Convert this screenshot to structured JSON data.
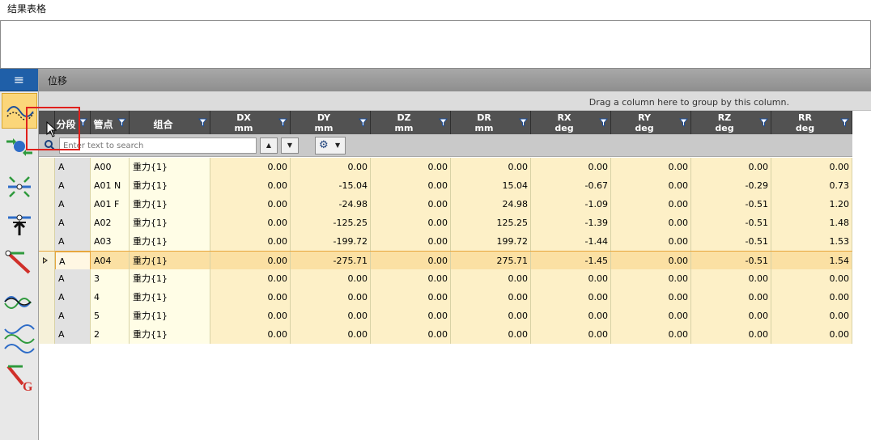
{
  "window": {
    "title": "结果表格"
  },
  "tab": {
    "label": "位移"
  },
  "group_panel": {
    "hint": "Drag a column here to group by this column."
  },
  "menu": {
    "icon": "≡"
  },
  "toolbar_tools": [
    {
      "name": "displacement-tool-icon",
      "active": true
    },
    {
      "name": "forces-tool-icon",
      "active": false
    },
    {
      "name": "stress-tool-icon",
      "active": false
    },
    {
      "name": "restraint-tool-icon",
      "active": false
    },
    {
      "name": "member-tool-icon",
      "active": false
    },
    {
      "name": "wave-tool-icon",
      "active": false
    },
    {
      "name": "modal-tool-icon",
      "active": false
    },
    {
      "name": "global-tool-icon",
      "active": false
    }
  ],
  "columns": [
    {
      "key": "seg",
      "line1": "分段",
      "line2": ""
    },
    {
      "key": "node",
      "line1": "管点",
      "line2": ""
    },
    {
      "key": "combo",
      "line1": "组合",
      "line2": ""
    },
    {
      "key": "dx",
      "line1": "DX",
      "line2": "mm"
    },
    {
      "key": "dy",
      "line1": "DY",
      "line2": "mm"
    },
    {
      "key": "dz",
      "line1": "DZ",
      "line2": "mm"
    },
    {
      "key": "dr",
      "line1": "DR",
      "line2": "mm"
    },
    {
      "key": "rx",
      "line1": "RX",
      "line2": "deg"
    },
    {
      "key": "ry",
      "line1": "RY",
      "line2": "deg"
    },
    {
      "key": "rz",
      "line1": "RZ",
      "line2": "deg"
    },
    {
      "key": "rr",
      "line1": "RR",
      "line2": "deg"
    }
  ],
  "search": {
    "placeholder": "Enter text to search",
    "up": "▲",
    "down": "▼",
    "gear": "⚙",
    "gear_dropdown": "▼"
  },
  "rows": [
    {
      "seg": "A",
      "node": "A00",
      "combo": "重力{1}",
      "dx": "0.00",
      "dy": "0.00",
      "dz": "0.00",
      "dr": "0.00",
      "rx": "0.00",
      "ry": "0.00",
      "rz": "0.00",
      "rr": "0.00",
      "selected": false
    },
    {
      "seg": "A",
      "node": "A01 N",
      "combo": "重力{1}",
      "dx": "0.00",
      "dy": "-15.04",
      "dz": "0.00",
      "dr": "15.04",
      "rx": "-0.67",
      "ry": "0.00",
      "rz": "-0.29",
      "rr": "0.73",
      "selected": false
    },
    {
      "seg": "A",
      "node": "A01 F",
      "combo": "重力{1}",
      "dx": "0.00",
      "dy": "-24.98",
      "dz": "0.00",
      "dr": "24.98",
      "rx": "-1.09",
      "ry": "0.00",
      "rz": "-0.51",
      "rr": "1.20",
      "selected": false
    },
    {
      "seg": "A",
      "node": "A02",
      "combo": "重力{1}",
      "dx": "0.00",
      "dy": "-125.25",
      "dz": "0.00",
      "dr": "125.25",
      "rx": "-1.39",
      "ry": "0.00",
      "rz": "-0.51",
      "rr": "1.48",
      "selected": false
    },
    {
      "seg": "A",
      "node": "A03",
      "combo": "重力{1}",
      "dx": "0.00",
      "dy": "-199.72",
      "dz": "0.00",
      "dr": "199.72",
      "rx": "-1.44",
      "ry": "0.00",
      "rz": "-0.51",
      "rr": "1.53",
      "selected": false
    },
    {
      "seg": "A",
      "node": "A04",
      "combo": "重力{1}",
      "dx": "0.00",
      "dy": "-275.71",
      "dz": "0.00",
      "dr": "275.71",
      "rx": "-1.45",
      "ry": "0.00",
      "rz": "-0.51",
      "rr": "1.54",
      "selected": true
    },
    {
      "seg": "A",
      "node": "3",
      "combo": "重力{1}",
      "dx": "0.00",
      "dy": "0.00",
      "dz": "0.00",
      "dr": "0.00",
      "rx": "0.00",
      "ry": "0.00",
      "rz": "0.00",
      "rr": "0.00",
      "selected": false
    },
    {
      "seg": "A",
      "node": "4",
      "combo": "重力{1}",
      "dx": "0.00",
      "dy": "0.00",
      "dz": "0.00",
      "dr": "0.00",
      "rx": "0.00",
      "ry": "0.00",
      "rz": "0.00",
      "rr": "0.00",
      "selected": false
    },
    {
      "seg": "A",
      "node": "5",
      "combo": "重力{1}",
      "dx": "0.00",
      "dy": "0.00",
      "dz": "0.00",
      "dr": "0.00",
      "rx": "0.00",
      "ry": "0.00",
      "rz": "0.00",
      "rr": "0.00",
      "selected": false
    },
    {
      "seg": "A",
      "node": "2",
      "combo": "重力{1}",
      "dx": "0.00",
      "dy": "0.00",
      "dz": "0.00",
      "dr": "0.00",
      "rx": "0.00",
      "ry": "0.00",
      "rz": "0.00",
      "rr": "0.00",
      "selected": false
    }
  ]
}
